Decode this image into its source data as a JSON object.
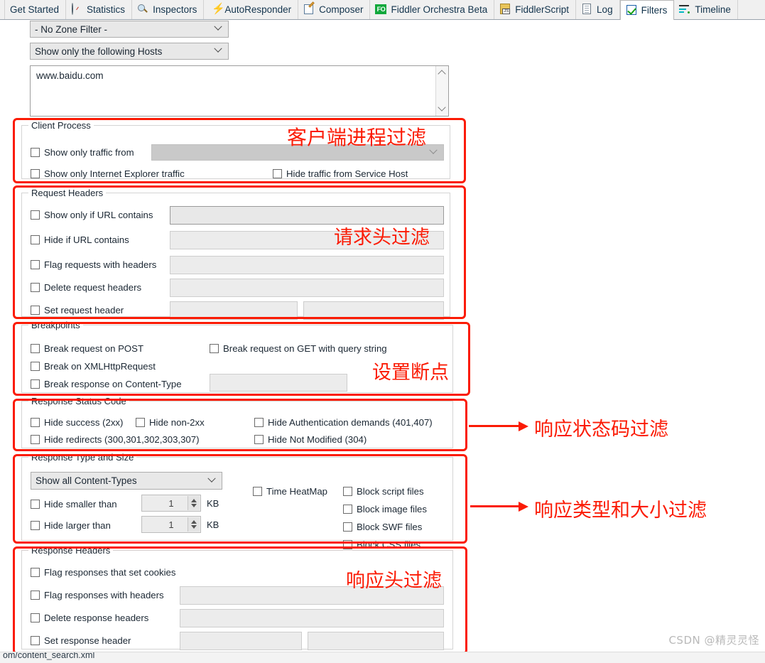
{
  "tabs": [
    {
      "label": "Get Started",
      "icon": "none",
      "active": false
    },
    {
      "label": "Statistics",
      "icon": "clock-icon",
      "active": false
    },
    {
      "label": "Inspectors",
      "icon": "magnifier-icon",
      "active": false
    },
    {
      "label": "AutoResponder",
      "icon": "lightning-icon",
      "active": false
    },
    {
      "label": "Composer",
      "icon": "notepad-pencil-icon",
      "active": false
    },
    {
      "label": "Fiddler Orchestra Beta",
      "icon": "fo-badge-icon",
      "active": false
    },
    {
      "label": "FiddlerScript",
      "icon": "script-js-icon",
      "active": false
    },
    {
      "label": "Log",
      "icon": "log-document-icon",
      "active": false
    },
    {
      "label": "Filters",
      "icon": "checked-box-icon",
      "active": true
    },
    {
      "label": "Timeline",
      "icon": "timeline-icon",
      "active": false
    }
  ],
  "zone_filter": {
    "value": "- No Zone Filter -"
  },
  "host_filter": {
    "value": "Show only the following Hosts"
  },
  "hosts_textarea": {
    "value": "www.baidu.com"
  },
  "client_process": {
    "legend": "Client Process",
    "show_only_traffic_from": {
      "label": "Show only traffic from",
      "value": ""
    },
    "show_only_ie_traffic": {
      "label": "Show only Internet Explorer traffic"
    },
    "hide_service_host": {
      "label": "Hide traffic from Service Host"
    },
    "annotation": "客户端进程过滤"
  },
  "request_headers": {
    "legend": "Request Headers",
    "rows": [
      {
        "label": "Show only if URL contains",
        "value": ""
      },
      {
        "label": "Hide if URL contains",
        "value": ""
      },
      {
        "label": "Flag requests with headers",
        "value": ""
      },
      {
        "label": "Delete request headers",
        "value": ""
      },
      {
        "label": "Set request header",
        "value": "",
        "value2": ""
      }
    ],
    "annotation": "请求头过滤"
  },
  "breakpoints": {
    "legend": "Breakpoints",
    "break_post": {
      "label": "Break request on POST"
    },
    "break_xhr": {
      "label": "Break on XMLHttpRequest"
    },
    "break_content_type": {
      "label": "Break response on Content-Type",
      "value": ""
    },
    "break_get_query": {
      "label": "Break request on GET with query string"
    },
    "annotation": "设置断点"
  },
  "response_status": {
    "legend": "Response Status Code",
    "hide_success": {
      "label": "Hide success (2xx)"
    },
    "hide_non2xx": {
      "label": "Hide non-2xx"
    },
    "hide_auth": {
      "label": "Hide Authentication demands (401,407)"
    },
    "hide_redirects": {
      "label": "Hide redirects (300,301,302,303,307)"
    },
    "hide_not_modified": {
      "label": "Hide Not Modified (304)"
    },
    "annotation": "响应状态码过滤"
  },
  "response_type_size": {
    "legend": "Response Type and Size",
    "content_types": {
      "value": "Show all Content-Types"
    },
    "hide_smaller": {
      "label": "Hide smaller than",
      "value": "1",
      "unit": "KB"
    },
    "hide_larger": {
      "label": "Hide larger than",
      "value": "1",
      "unit": "KB"
    },
    "time_heatmap": {
      "label": "Time HeatMap"
    },
    "block_script": {
      "label": "Block script files"
    },
    "block_image": {
      "label": "Block image files"
    },
    "block_swf": {
      "label": "Block SWF files"
    },
    "block_css": {
      "label": "Block CSS files"
    },
    "annotation": "响应类型和大小过滤"
  },
  "response_headers": {
    "legend": "Response Headers",
    "flag_cookies": {
      "label": "Flag responses that set cookies"
    },
    "rows": [
      {
        "label": "Flag responses with headers",
        "value": ""
      },
      {
        "label": "Delete response headers",
        "value": ""
      },
      {
        "label": "Set response header",
        "value": "",
        "value2": ""
      }
    ],
    "annotation": "响应头过滤"
  },
  "watermark": "CSDN @精灵灵怪",
  "statusbar": {
    "text": "om/content_search.xml"
  },
  "colors": {
    "highlight": "#fb1b05",
    "tab_text": "#13344d",
    "accent_green": "#12a83c"
  }
}
